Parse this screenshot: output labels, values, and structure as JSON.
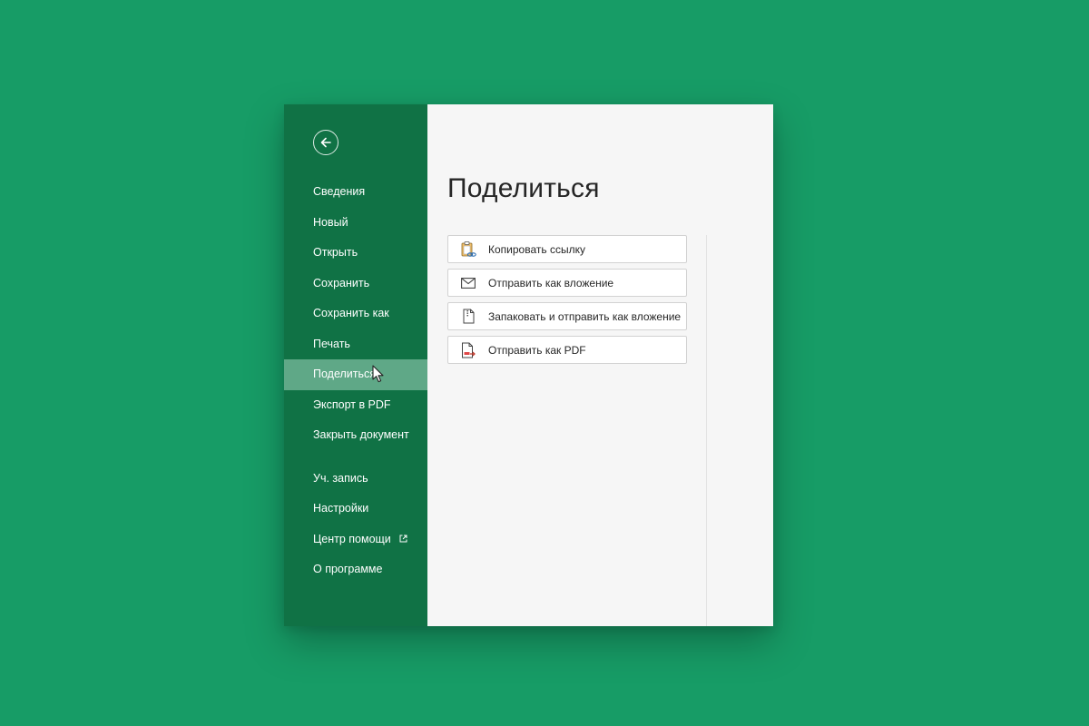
{
  "sidebar": {
    "items": [
      {
        "label": "Сведения"
      },
      {
        "label": "Новый"
      },
      {
        "label": "Открыть"
      },
      {
        "label": "Сохранить"
      },
      {
        "label": "Сохранить как"
      },
      {
        "label": "Печать"
      },
      {
        "label": "Поделиться",
        "active": true
      },
      {
        "label": "Экспорт в PDF"
      },
      {
        "label": "Закрыть документ"
      }
    ],
    "bottom_items": [
      {
        "label": "Уч. запись"
      },
      {
        "label": "Настройки"
      },
      {
        "label": "Центр помощи",
        "icon": "external-link-icon"
      },
      {
        "label": "О программе"
      }
    ]
  },
  "main": {
    "title": "Поделиться",
    "share_options": [
      {
        "label": "Копировать ссылку",
        "icon": "clipboard-link-icon"
      },
      {
        "label": "Отправить как вложение",
        "icon": "envelope-icon"
      },
      {
        "label": "Запаковать и отправить как вложение",
        "icon": "zip-file-icon"
      },
      {
        "label": "Отправить как PDF",
        "icon": "pdf-file-icon"
      }
    ]
  },
  "colors": {
    "background": "#179c66",
    "sidebar": "#107245",
    "sidebar_active": "#5fa887",
    "main_bg": "#f6f6f6"
  }
}
